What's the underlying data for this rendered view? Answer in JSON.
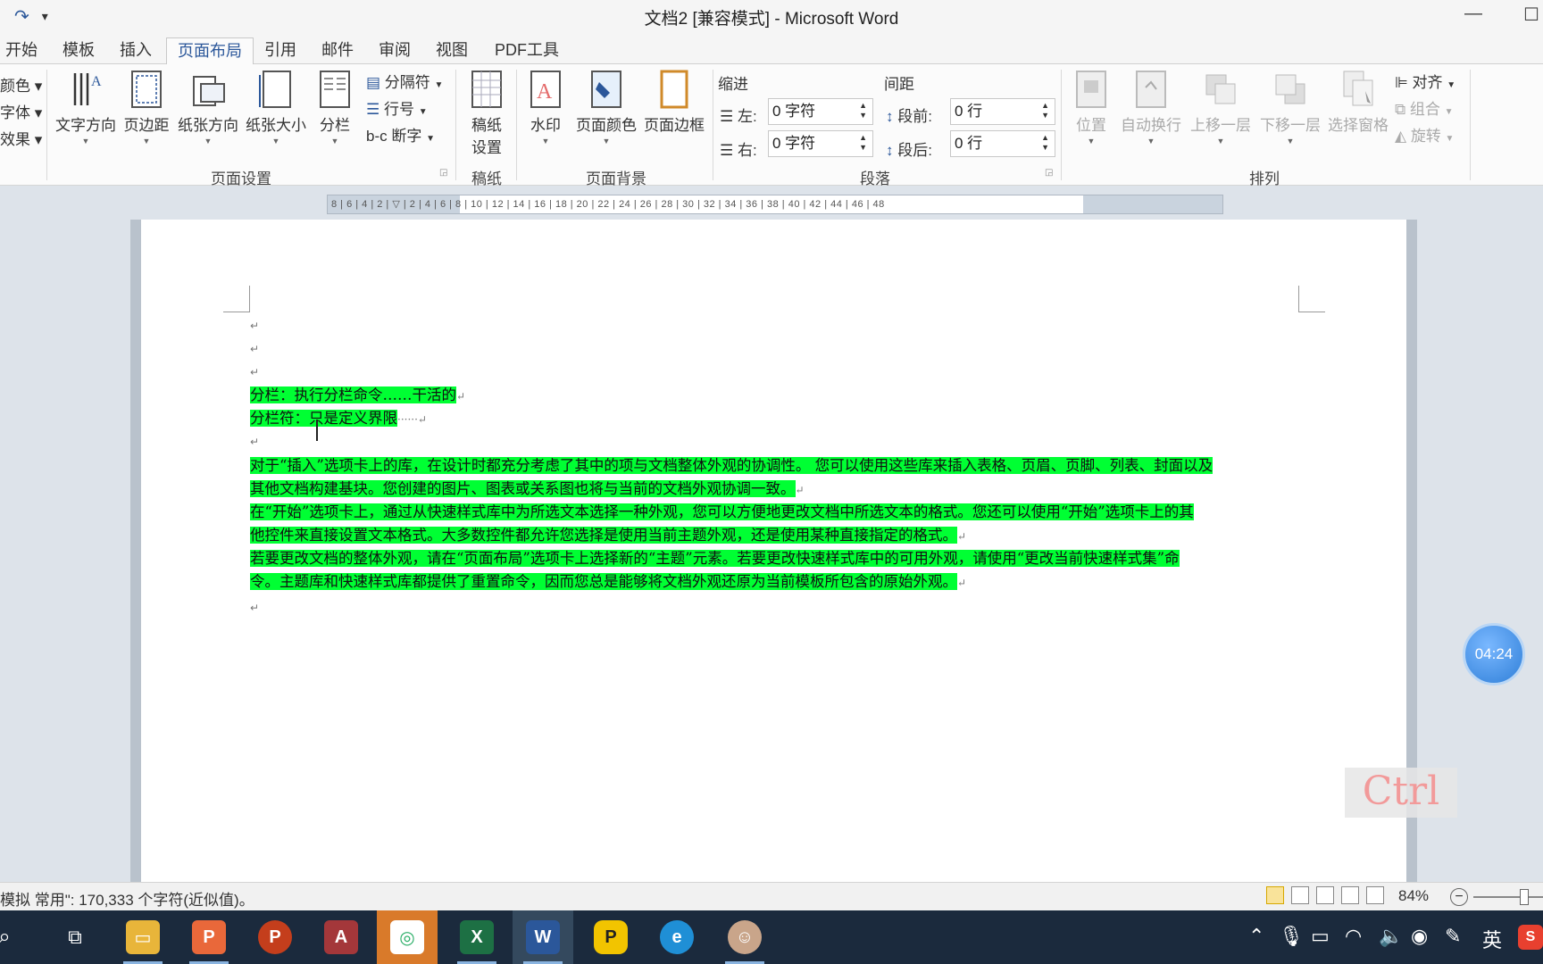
{
  "window": {
    "title": "文档2 [兼容模式] - Microsoft Word",
    "redo_icon": "redo-icon",
    "customize_icon": "customize-qat-icon"
  },
  "tabs": [
    "开始",
    "模板",
    "插入",
    "页面布局",
    "引用",
    "邮件",
    "审阅",
    "视图",
    "PDF工具"
  ],
  "active_tab": "页面布局",
  "ribbon": {
    "theme": {
      "colors": "颜色",
      "fonts": "字体",
      "effects": "效果"
    },
    "page_setup": {
      "label": "页面设置",
      "text_direction": "文字方向",
      "margins": "页边距",
      "orientation": "纸张方向",
      "size": "纸张大小",
      "columns": "分栏",
      "breaks": "分隔符",
      "line_numbers": "行号",
      "hyphenation": "断字"
    },
    "manuscript": {
      "label": "稿纸",
      "setup_line1": "稿纸",
      "setup_line2": "设置"
    },
    "page_background": {
      "label": "页面背景",
      "watermark": "水印",
      "page_color": "页面颜色",
      "page_borders": "页面边框"
    },
    "paragraph": {
      "label": "段落",
      "indent_head": "缩进",
      "spacing_head": "间距",
      "left_label": "左:",
      "left_value": "0 字符",
      "right_label": "右:",
      "right_value": "0 字符",
      "before_label": "段前:",
      "before_value": "0 行",
      "after_label": "段后:",
      "after_value": "0 行"
    },
    "arrange": {
      "label": "排列",
      "position": "位置",
      "wrap_text": "自动换行",
      "bring_forward": "上移一层",
      "send_backward": "下移一层",
      "selection_pane": "选择窗格",
      "align": "对齐",
      "group": "组合",
      "rotate": "旋转"
    }
  },
  "ruler": {
    "ticks": "8 | 6 | 4 | 2 | ▽ | 2 | 4 | 6 | 8 | 10 | 12 | 14 | 16 | 18 | 20 | 22 | 24 | 26 | 28 | 30 | 32 | 34 | 36 | 38 | 40 | 42 | 44 | 46 | 48"
  },
  "document": {
    "line1": "分栏：执行分栏命令……干活的",
    "line2": "分栏符：只是定义界限",
    "block1": [
      "对于“插入”选项卡上的库，在设计时都充分考虑了其中的项与文档整体外观的协调性。 您可以使用这些库来插入表格、页眉、页脚、列表、封面以及",
      "其他文档构建基块。您创建的图片、图表或关系图也将与当前的文档外观协调一致。"
    ],
    "block2": [
      "在“开始”选项卡上，通过从快速样式库中为所选文本选择一种外观，您可以方便地更改文档中所选文本的格式。您还可以使用“开始”选项卡上的其",
      "他控件来直接设置文本格式。大多数控件都允许您选择是使用当前主题外观，还是使用某种直接指定的格式。"
    ],
    "block3": [
      "若要更改文档的整体外观，请在“页面布局”选项卡上选择新的“主题”元素。若要更改快速样式库中的可用外观，请使用“更改当前快速样式集”命",
      "令。主题库和快速样式库都提供了重置命令，因而您总是能够将文档外观还原为当前模板所包含的原始外观。"
    ],
    "para_mark": "↵"
  },
  "overlay": {
    "timer": "04:24",
    "key": "Ctrl"
  },
  "status": {
    "message": "模拟 常用\": 170,333 个字符(近似值)。",
    "zoom": "84%",
    "zoom_minus": "−"
  },
  "taskbar": {
    "apps": [
      "file-explorer",
      "wps-presentation",
      "powerpoint",
      "access",
      "wechat",
      "excel",
      "word",
      "pdf-tool",
      "edge",
      "user-avatar"
    ],
    "ime": "英"
  },
  "colors": {
    "highlight": "#00ff33",
    "accent": "#2b579a",
    "taskbar": "#1b2a3d"
  }
}
